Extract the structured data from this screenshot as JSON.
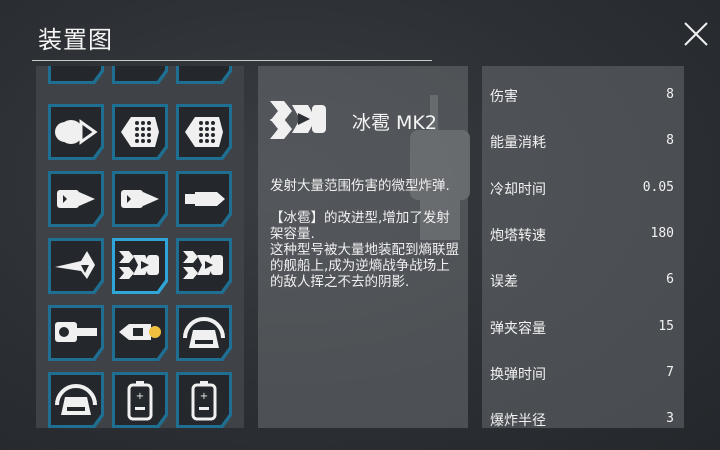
{
  "header": {
    "title": "装置图"
  },
  "grid": {
    "slots": [
      {
        "icon": "missile-cluster-icon"
      },
      {
        "icon": "missile-cluster-icon"
      },
      {
        "icon": "turret-launcher-icon"
      },
      {
        "icon": "bomb-pod-icon"
      },
      {
        "icon": "cluster-bomb-icon"
      },
      {
        "icon": "cluster-bomb-icon"
      },
      {
        "icon": "torpedo-icon"
      },
      {
        "icon": "torpedo-icon"
      },
      {
        "icon": "drill-missile-icon"
      },
      {
        "icon": "star-missile-icon"
      },
      {
        "icon": "hail-bomb-icon"
      },
      {
        "icon": "hail-bomb-icon"
      },
      {
        "icon": "cannon-icon"
      },
      {
        "icon": "flame-torpedo-icon"
      },
      {
        "icon": "dome-icon"
      },
      {
        "icon": "dome-icon"
      },
      {
        "icon": "battery-icon"
      },
      {
        "icon": "battery-icon"
      }
    ],
    "selected_index": 10
  },
  "item": {
    "icon": "hail-bomb-icon",
    "name": "冰雹 MK2",
    "description": "发射大量范围伤害的微型炸弹.\n\n【冰雹】的改进型,增加了发射架容量.\n这种型号被大量地装配到熵联盟的舰船上,成为逆熵战争战场上的敌人挥之不去的阴影."
  },
  "stats": [
    {
      "label": "伤害",
      "value": "8"
    },
    {
      "label": "能量消耗",
      "value": "8"
    },
    {
      "label": "冷却时间",
      "value": "0.05"
    },
    {
      "label": "炮塔转速",
      "value": "180"
    },
    {
      "label": "误差",
      "value": "6"
    },
    {
      "label": "弹夹容量",
      "value": "15"
    },
    {
      "label": "换弹时间",
      "value": "7"
    },
    {
      "label": "爆炸半径",
      "value": "3"
    }
  ],
  "colors": {
    "slot_border": "#1f6f93",
    "slot_selected": "#30a6d8",
    "accent": "#f0c040"
  }
}
